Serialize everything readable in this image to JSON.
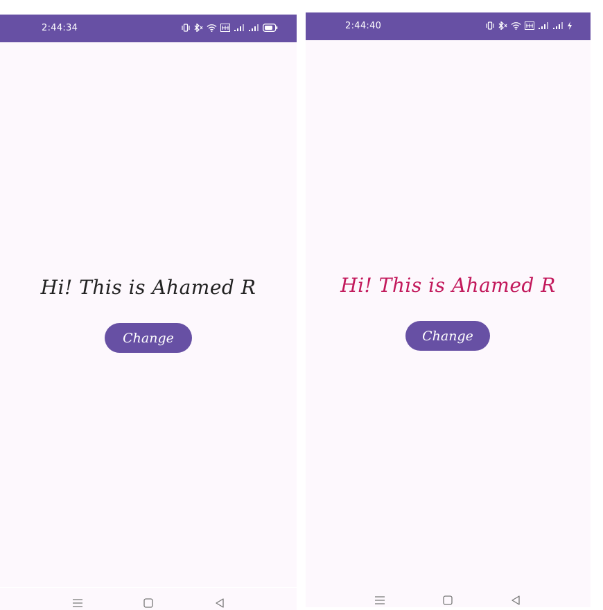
{
  "colors": {
    "status_bar": "#6750a4",
    "button": "#6750a4",
    "background": "#fdf8fd",
    "text_default": "#222222",
    "text_changed": "#c2185b"
  },
  "screens": [
    {
      "status_bar": {
        "time": "2:44:34",
        "icons": [
          "vibrate-icon",
          "bluetooth-icon",
          "wifi-icon",
          "volte-icon",
          "signal-icon",
          "signal-icon",
          "battery-icon"
        ]
      },
      "greeting": "Hi! This is Ahamed R",
      "button_label": "Change",
      "nav": [
        "menu-icon",
        "home-icon",
        "back-icon"
      ]
    },
    {
      "status_bar": {
        "time": "2:44:40",
        "icons": [
          "vibrate-icon",
          "bluetooth-icon",
          "wifi-icon",
          "volte-icon",
          "signal-icon",
          "signal-icon",
          "charging-icon"
        ]
      },
      "greeting": "Hi! This is Ahamed R",
      "button_label": "Change",
      "nav": [
        "menu-icon",
        "home-icon",
        "back-icon"
      ]
    }
  ]
}
